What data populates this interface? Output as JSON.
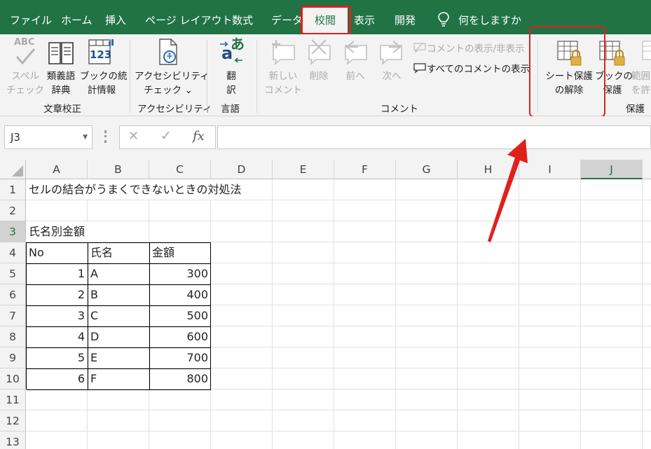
{
  "tabs": [
    {
      "label": "ファイル"
    },
    {
      "label": "ホーム"
    },
    {
      "label": "挿入"
    },
    {
      "label": "ページ レイアウト"
    },
    {
      "label": "数式"
    },
    {
      "label": "データ"
    },
    {
      "label": "校閲"
    },
    {
      "label": "表示"
    },
    {
      "label": "開発"
    }
  ],
  "tell_me": "何をしますか",
  "ribbon": {
    "spelling": {
      "line1": "スペル",
      "line2": "チェック",
      "icon_text": "ABC"
    },
    "thesaurus": {
      "line1": "類義語",
      "line2": "辞典"
    },
    "workbook_stats": {
      "line1": "ブックの統",
      "line2": "計情報",
      "icon_text": "123"
    },
    "group_proofing": "文章校正",
    "accessibility": {
      "line1": "アクセシビリティ",
      "line2": "チェック ⌄"
    },
    "group_accessibility": "アクセシビリティ",
    "translate": {
      "line1": "翻",
      "line2": "訳",
      "icon_text_a": "a",
      "icon_text_ja": "あ"
    },
    "group_language": "言語",
    "new_comment": {
      "line1": "新しい",
      "line2": "コメント"
    },
    "delete_comment": "削除",
    "prev_comment": "前へ",
    "next_comment": "次へ",
    "show_hide_comment": "コメントの表示/非表示",
    "show_all_comments": "すべてのコメントの表示",
    "group_comments": "コメント",
    "unprotect_sheet": {
      "line1": "シート保護",
      "line2": "の解除"
    },
    "protect_workbook": {
      "line1": "ブックの",
      "line2": "保護"
    },
    "allow_edit_ranges": {
      "line1": "範囲",
      "line2": "を許"
    },
    "group_protect": "保護"
  },
  "formula_bar": {
    "name_box": "J3",
    "cancel": "✕",
    "enter": "✓",
    "fx": "fx"
  },
  "columns": [
    "A",
    "B",
    "C",
    "D",
    "E",
    "F",
    "G",
    "H",
    "I",
    "J"
  ],
  "rows": [
    "1",
    "2",
    "3",
    "4",
    "5",
    "6",
    "7",
    "8",
    "9",
    "10",
    "11",
    "12",
    "13"
  ],
  "sheet": {
    "a1": "セルの結合がうまくできないときの対処法",
    "a3": "氏名別金額",
    "headers": [
      "No",
      "氏名",
      "金額"
    ],
    "table": [
      {
        "no": "1",
        "name": "A",
        "amount": "300"
      },
      {
        "no": "2",
        "name": "B",
        "amount": "400"
      },
      {
        "no": "3",
        "name": "C",
        "amount": "500"
      },
      {
        "no": "4",
        "name": "D",
        "amount": "600"
      },
      {
        "no": "5",
        "name": "E",
        "amount": "700"
      },
      {
        "no": "6",
        "name": "F",
        "amount": "800"
      }
    ]
  },
  "colors": {
    "excel_green": "#217346",
    "highlight_red": "#e0201b"
  }
}
